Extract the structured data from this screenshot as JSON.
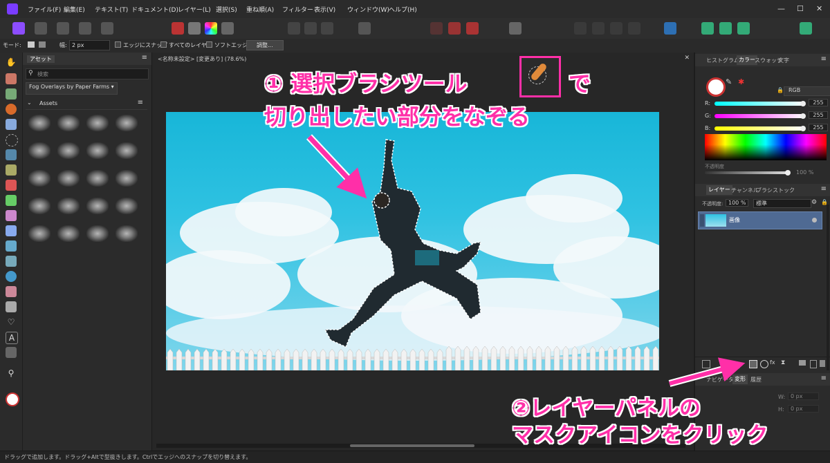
{
  "menu": [
    "ファイル(F)",
    "編集(E)",
    "テキスト(T)",
    "ドキュメント(D)",
    "レイヤー(L)",
    "選択(S)",
    "重ね順(A)",
    "フィルター",
    "表示(V)",
    "ウィンドウ(W)",
    "ヘルプ(H)"
  ],
  "window_controls": {
    "minimize": "—",
    "maximize": "☐",
    "close": "✕"
  },
  "context_bar": {
    "mode_label": "モード:",
    "width_label": "幅:",
    "width_value": "2 px",
    "snap_edges": "エッジにスナップ",
    "all_layers": "すべてのレイヤー",
    "soft_edge": "ソフトエッジ",
    "adjust_button": "調整..."
  },
  "assets_panel": {
    "tab": "アセット",
    "search_placeholder": "検索",
    "dropdown": "Fog Overlays by Paper Farms",
    "section": "Assets"
  },
  "document": {
    "tab_title": "<名称未設定> [変更あり] (78.6%)"
  },
  "right_panel": {
    "tabs": [
      "ヒストグラム",
      "カラー",
      "スウォッチ",
      "文字"
    ],
    "color_model": "RGB",
    "r_label": "R:",
    "g_label": "G:",
    "b_label": "B:",
    "r": "255",
    "g": "255",
    "b": "255",
    "opacity_label": "不透明度",
    "opacity_value": "100 %",
    "layer_tabs": [
      "レイヤー",
      "チャンネル",
      "ブラシ",
      "ストック"
    ],
    "layer_opacity_label": "不透明度:",
    "layer_opacity_value": "100 %",
    "blend_mode": "標準",
    "layer_name": "画像",
    "bottom_tabs": [
      "ナビゲータ",
      "変形",
      "履歴"
    ],
    "w_label": "W:",
    "w_value": "0 px",
    "h_label": "H:",
    "h_value": "0 px"
  },
  "status_text": "ドラッグで追加します。ドラッグ+Altで型抜きします。Ctrlでエッジへのスナップを切り替えます。",
  "annotations": {
    "step1_line1": "① 選択ブラシツール",
    "step1_de": "で",
    "step1_line2": "切り出したい部分をなぞる",
    "step2_line1": "②レイヤーパネルの",
    "step2_line2": "マスクアイコンをクリック"
  },
  "colors": {
    "accent": "#ff2fa8",
    "sky": "#2fc2e2",
    "panel": "#2b2b2b"
  }
}
